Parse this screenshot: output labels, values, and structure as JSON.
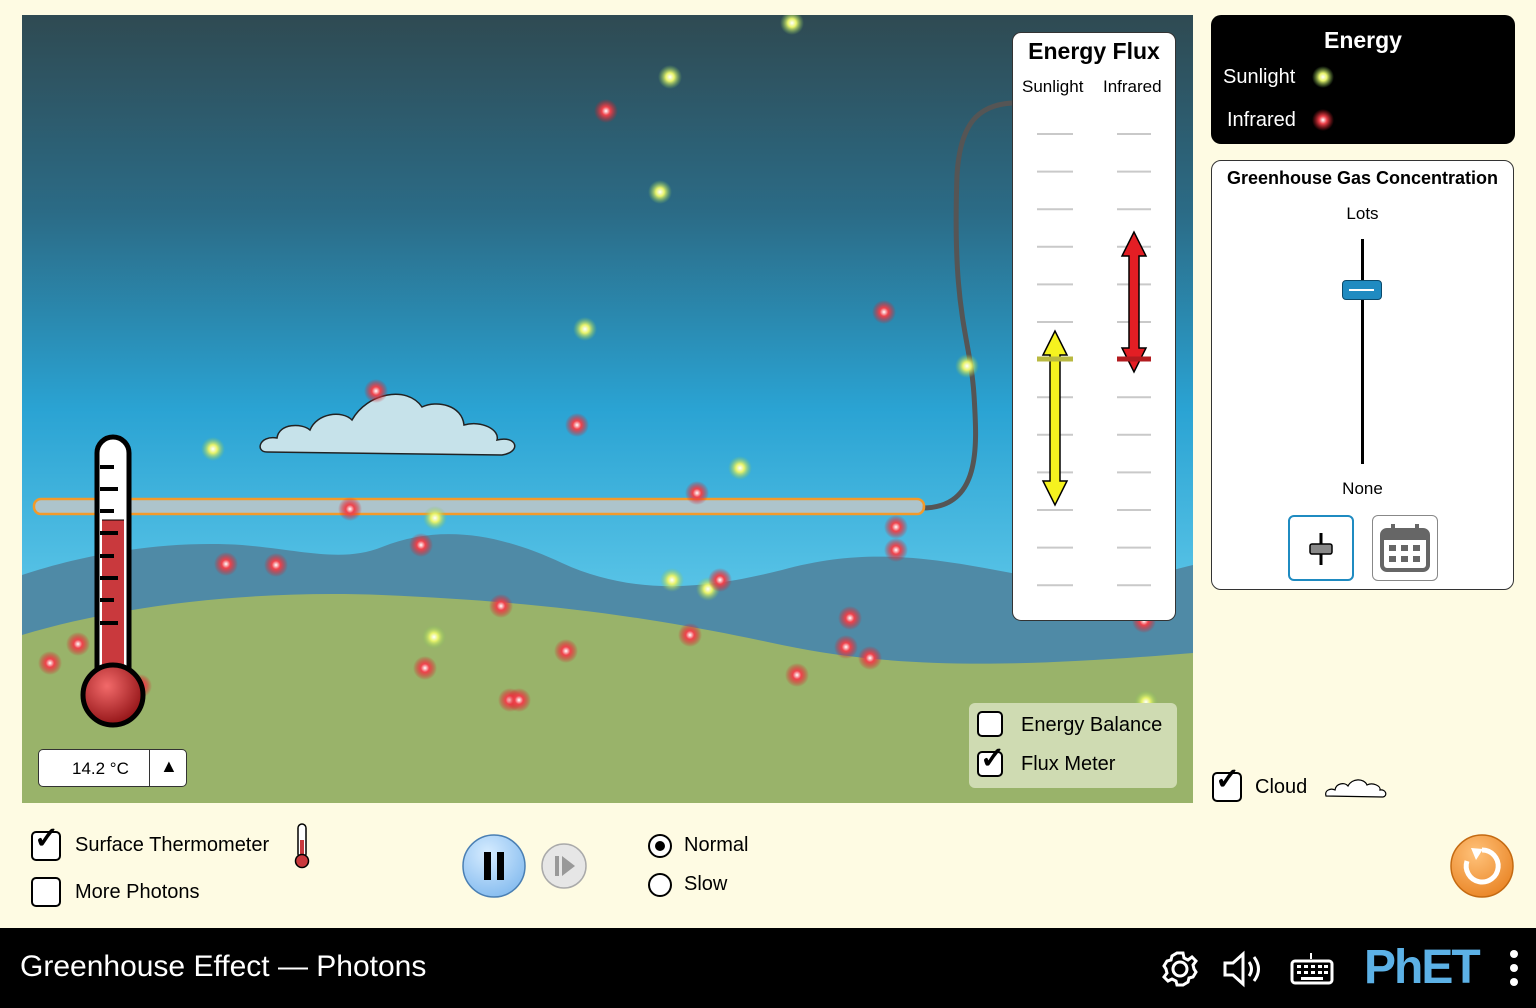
{
  "sim": {
    "flux_meter": {
      "title": "Energy Flux",
      "col_sunlight": "Sunlight",
      "col_infrared": "Infrared"
    },
    "thermometer": {
      "readout": "14.2 °C"
    },
    "overlay": {
      "energy_balance": {
        "label": "Energy Balance",
        "checked": false
      },
      "flux_meter": {
        "label": "Flux Meter",
        "checked": true
      }
    }
  },
  "legend": {
    "title": "Energy",
    "items": [
      {
        "label": "Sunlight",
        "color": "#f2f25a"
      },
      {
        "label": "Infrared",
        "color": "#e8313b"
      }
    ]
  },
  "ghg": {
    "title": "Greenhouse Gas Concentration",
    "top_label": "Lots",
    "bottom_label": "None",
    "slider_value": 0.77,
    "mode_buttons": [
      "slider-icon",
      "calendar-icon"
    ]
  },
  "cloud_toggle": {
    "label": "Cloud",
    "checked": true
  },
  "controls": {
    "surface_thermometer": {
      "label": "Surface Thermometer",
      "checked": true
    },
    "more_photons": {
      "label": "More Photons",
      "checked": false
    },
    "speed": {
      "options": [
        "Normal",
        "Slow"
      ],
      "selected": "Normal"
    }
  },
  "navbar": {
    "title": "Greenhouse Effect — Photons",
    "icons": [
      "gear-icon",
      "speaker-icon",
      "keyboard-icon",
      "phet-logo",
      "kebab-menu-icon"
    ],
    "logo_text": "PhET"
  },
  "colors": {
    "sunlight": "#f2f25a",
    "infrared": "#e8313b",
    "accent": "#2196c9",
    "reset": "#f39a2a"
  }
}
